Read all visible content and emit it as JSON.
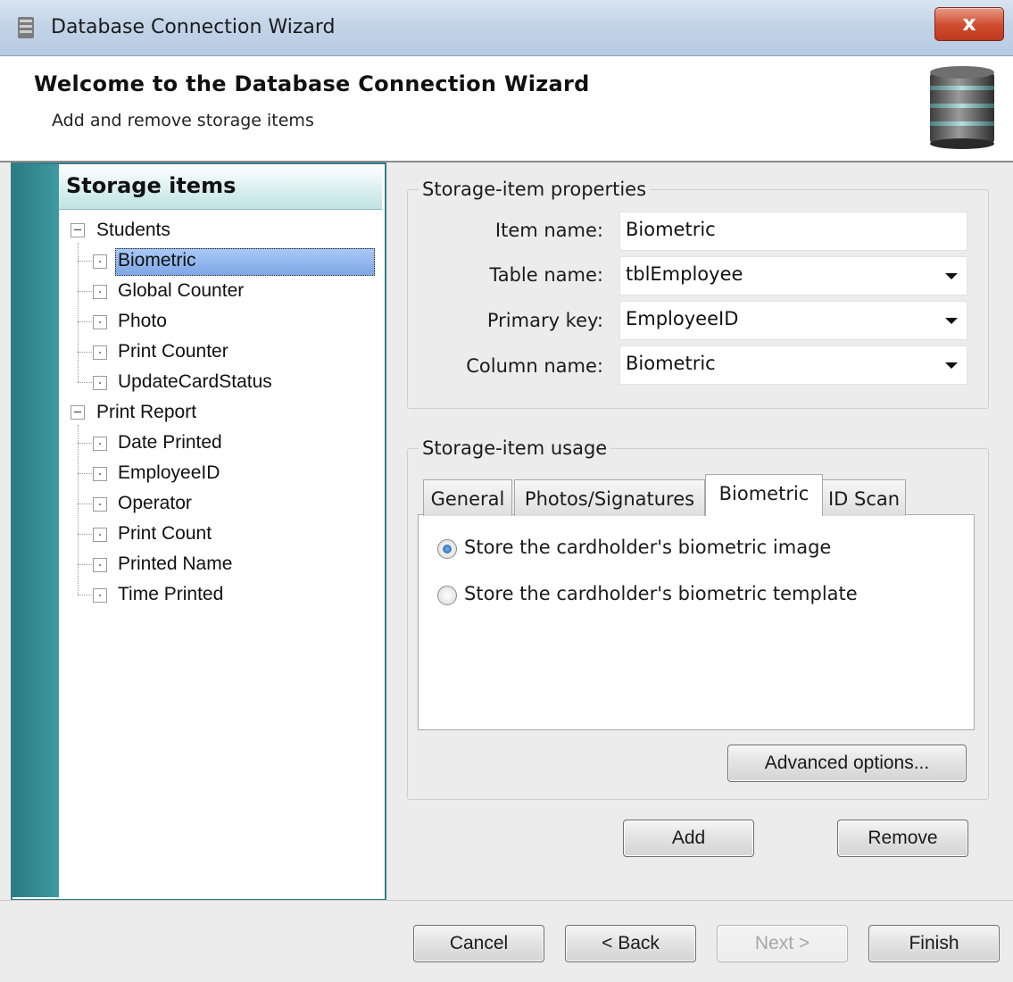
{
  "window": {
    "title": "Database Connection Wizard",
    "close_glyph": "x"
  },
  "header": {
    "title": "Welcome to the Database Connection Wizard",
    "subtitle": "Add and remove storage items"
  },
  "left_panel": {
    "title": "Storage items",
    "tree": [
      {
        "label": "Students",
        "children": [
          "Biometric",
          "Global Counter",
          "Photo",
          "Print Counter",
          "UpdateCardStatus"
        ]
      },
      {
        "label": "Print Report",
        "children": [
          "Date Printed",
          "EmployeeID",
          "Operator",
          "Print Count",
          "Printed Name",
          "Time Printed"
        ]
      }
    ],
    "selected": "Biometric"
  },
  "properties": {
    "group_title": "Storage-item properties",
    "item_name_label": "Item name:",
    "item_name_value": "Biometric",
    "table_name_label": "Table name:",
    "table_name_value": "tblEmployee",
    "primary_key_label": "Primary key:",
    "primary_key_value": "EmployeeID",
    "column_name_label": "Column name:",
    "column_name_value": "Biometric"
  },
  "usage": {
    "group_title": "Storage-item usage",
    "tabs": [
      "General",
      "Photos/Signatures",
      "Biometric",
      "ID Scan"
    ],
    "active_tab": "Biometric",
    "radio_image": "Store the cardholder's biometric image",
    "radio_template": "Store the cardholder's biometric template",
    "selected_radio": "image",
    "advanced_button": "Advanced options..."
  },
  "actions": {
    "add": "Add",
    "remove": "Remove"
  },
  "footer": {
    "cancel": "Cancel",
    "back": "< Back",
    "next": "Next >",
    "finish": "Finish"
  },
  "colors": {
    "accent_teal": "#2f7f86",
    "selection": "#8fb3ec",
    "close_red": "#cf4a2f"
  }
}
